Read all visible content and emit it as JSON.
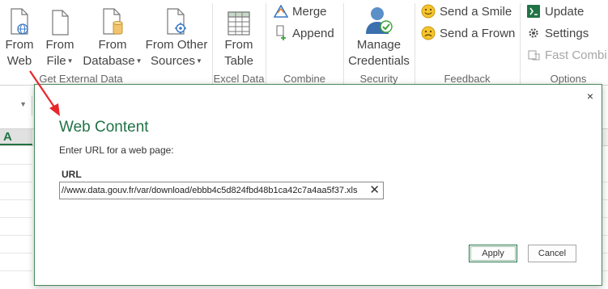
{
  "ribbon": {
    "get_external_data": {
      "group_label": "Get External Data",
      "from_web": [
        "From",
        "Web"
      ],
      "from_file": [
        "From",
        "File"
      ],
      "from_database": [
        "From",
        "Database"
      ],
      "from_other_sources": [
        "From Other",
        "Sources"
      ]
    },
    "excel_data": {
      "group_label": "Excel Data",
      "from_table": [
        "From",
        "Table"
      ]
    },
    "combine": {
      "group_label": "Combine",
      "merge": "Merge",
      "append": "Append"
    },
    "security": {
      "group_label": "Security",
      "manage_credentials": [
        "Manage",
        "Credentials"
      ]
    },
    "feedback": {
      "group_label": "Feedback",
      "send_smile": "Send a Smile",
      "send_frown": "Send a Frown"
    },
    "options": {
      "group_label": "Options",
      "update": "Update",
      "settings": "Settings",
      "fast_combine": "Fast Combi"
    }
  },
  "sheet": {
    "column_a": "A"
  },
  "dialog": {
    "close_glyph": "×",
    "title": "Web Content",
    "instruction": "Enter URL for a web page:",
    "url_label": "URL",
    "url_value": "//www.data.gouv.fr/var/download/ebbb4c5d824fbd48b1ca42c7a4aa5f37.xls",
    "url_clear_glyph": "✕",
    "apply_label": "Apply",
    "cancel_label": "Cancel"
  },
  "colors": {
    "accent_green": "#217346",
    "annotation_red": "#e8262b",
    "smile_yellow": "#f5c32c"
  }
}
